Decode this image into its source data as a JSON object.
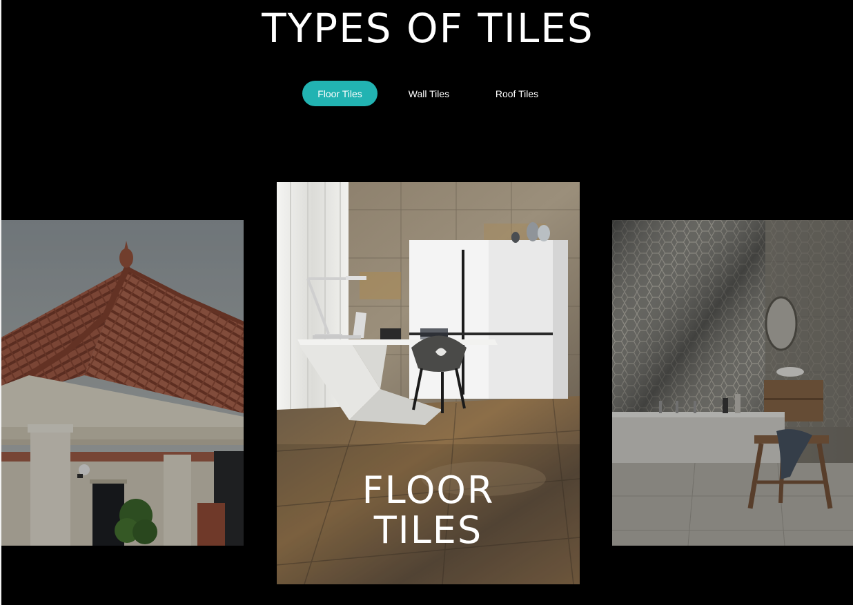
{
  "page": {
    "title": "TYPES OF TILES"
  },
  "tabs": [
    {
      "label": "Floor Tiles",
      "active": true
    },
    {
      "label": "Wall Tiles",
      "active": false
    },
    {
      "label": "Roof Tiles",
      "active": false
    }
  ],
  "carousel": {
    "center": {
      "caption_line1": "FLOOR",
      "caption_line2": "TILES"
    }
  },
  "colors": {
    "background": "#000000",
    "accent": "#22b3b2",
    "text": "#ffffff"
  }
}
